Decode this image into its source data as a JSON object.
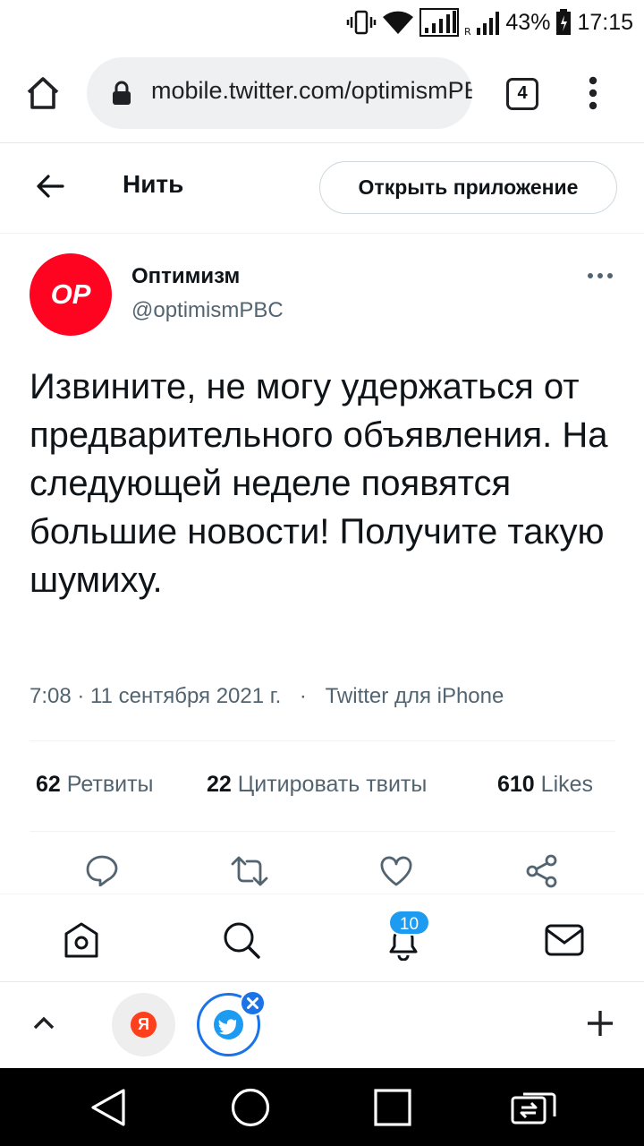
{
  "status_bar": {
    "battery": "43%",
    "time": "17:15"
  },
  "browser": {
    "url": "mobile.twitter.com/optimismPBC",
    "tab_count": "4"
  },
  "thread_header": {
    "title": "Нить",
    "open_app_label": "Открыть приложение"
  },
  "tweet": {
    "avatar_text": "OP",
    "author_name": "Оптимизм",
    "author_handle": "@optimismPBC",
    "text": "Извините, не могу удержаться от предварительного объявления. На следующей неделе появятся большие новости! Получите такую шумиху.",
    "timestamp": "7:08 · 11 сентября 2021 г.",
    "separator": "·",
    "source": "Twitter для iPhone",
    "stats": {
      "retweets_count": "62",
      "retweets_label": "Ретвиты",
      "quotes_count": "22",
      "quotes_label": "Цитировать твиты",
      "likes_count": "610",
      "likes_label": "Likes"
    }
  },
  "bottom_nav": {
    "notifications_badge": "10"
  },
  "tab_strip": {
    "yandex_letter": "Я"
  },
  "colors": {
    "avatar_bg": "#ff0420",
    "twitter_blue": "#1d9bf0",
    "chrome_blue": "#1a73e8"
  }
}
